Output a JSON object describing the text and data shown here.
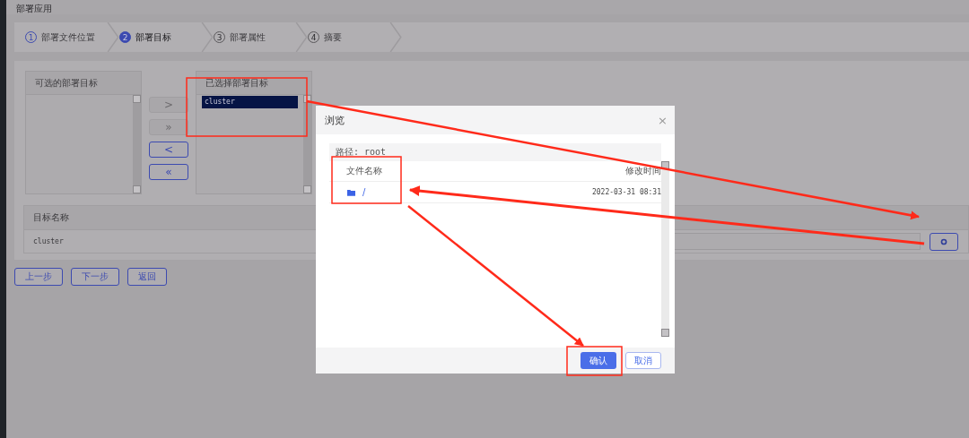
{
  "window": {
    "title": "部署应用"
  },
  "steps": [
    {
      "number": "1",
      "label": "部署文件位置",
      "selected": false,
      "completed": true
    },
    {
      "number": "2",
      "label": "部署目标",
      "selected": true,
      "completed": false
    },
    {
      "number": "3",
      "label": "部署属性",
      "selected": false,
      "completed": false
    },
    {
      "number": "4",
      "label": "摘要",
      "selected": false,
      "completed": false
    }
  ],
  "available_targets": {
    "title": "可选的部署目标"
  },
  "transfer_buttons": [
    {
      "label": ">",
      "disabled": true
    },
    {
      "label": "»",
      "disabled": true
    },
    {
      "label": "<",
      "disabled": false
    },
    {
      "label": "«",
      "disabled": false
    }
  ],
  "selected_targets": {
    "title": "已选择部署目标",
    "items": [
      {
        "label": "cluster",
        "selected": true
      }
    ]
  },
  "target_table": {
    "columns": [
      "目标名称"
    ],
    "rows": [
      {
        "name": "cluster"
      }
    ]
  },
  "footer_buttons": [
    "上一步",
    "下一步",
    "返回"
  ],
  "dialog": {
    "title": "浏览",
    "close": "×",
    "path": "路径: root",
    "columns": [
      "文件名称",
      "修改时间"
    ],
    "rows": [
      {
        "name": "/",
        "modified": "2022-03-31 08:31"
      }
    ],
    "buttons": [
      {
        "label": "确认",
        "kind": "primary"
      },
      {
        "label": "取消",
        "kind": "default"
      }
    ]
  }
}
